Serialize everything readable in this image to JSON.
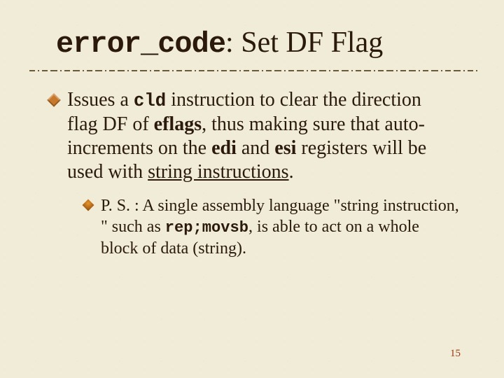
{
  "title": {
    "code": "error_code",
    "rest": ": Set DF Flag"
  },
  "bullet1": {
    "p1": "Issues a ",
    "code1": "cld",
    "p2": " instruction to clear the direction flag DF of ",
    "b1": "eflags",
    "p3": ", thus making sure that auto-increments on the ",
    "b2": "edi",
    "p4": " and ",
    "b3": "esi",
    "p5": " registers will be used with ",
    "u1": "string instructions",
    "p6": "."
  },
  "sub1": {
    "p1": "P. S. : A single assembly language \"string instruction, \" such as ",
    "code1": "rep;movsb",
    "p2": ", is able to act on a whole block of data (string)."
  },
  "page": "15"
}
